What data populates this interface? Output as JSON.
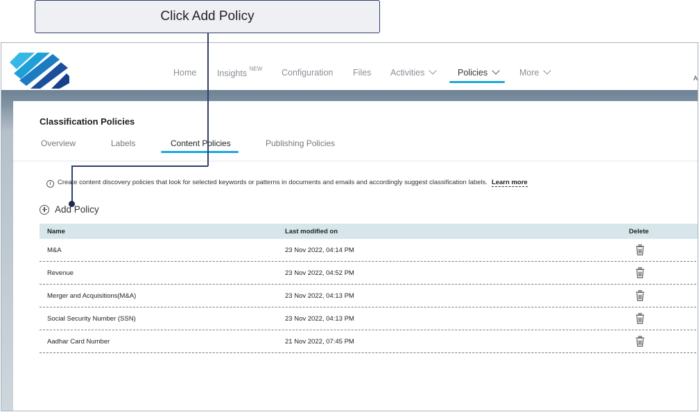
{
  "callout": {
    "text": "Click Add Policy"
  },
  "nav": {
    "items": [
      {
        "label": "Home"
      },
      {
        "label": "Insights",
        "badge": "NEW"
      },
      {
        "label": "Configuration"
      },
      {
        "label": "Files"
      },
      {
        "label": "Activities"
      },
      {
        "label": "Policies"
      },
      {
        "label": "More"
      }
    ],
    "active": "Policies",
    "edge_text": "A"
  },
  "page": {
    "title": "Classification Policies",
    "tabs": [
      {
        "label": "Overview"
      },
      {
        "label": "Labels"
      },
      {
        "label": "Content Policies"
      },
      {
        "label": "Publishing Policies"
      }
    ],
    "active_tab": "Content Policies",
    "info_text": "Create content discovery policies that look for selected keywords or patterns in documents and emails and accordingly suggest classification labels.",
    "learn_more": "Learn more",
    "add_policy": "Add Policy"
  },
  "table": {
    "columns": [
      "Name",
      "Last modified on",
      "Delete"
    ],
    "rows": [
      {
        "name": "M&A",
        "modified": "23 Nov 2022, 04:14 PM"
      },
      {
        "name": "Revenue",
        "modified": "23 Nov 2022, 04:52 PM"
      },
      {
        "name": "Merger and Acquisitions(M&A)",
        "modified": "23 Nov 2022, 04:13 PM"
      },
      {
        "name": "Social Security Number (SSN)",
        "modified": "23 Nov 2022, 04:13 PM"
      },
      {
        "name": "Aadhar Card Number",
        "modified": "21 Nov 2022, 07:45 PM"
      }
    ]
  },
  "colors": {
    "accent": "#1ea6d9",
    "header_bar": "#6d8294",
    "table_header": "#d6e6ea",
    "callout_border": "#2f3e6b"
  }
}
